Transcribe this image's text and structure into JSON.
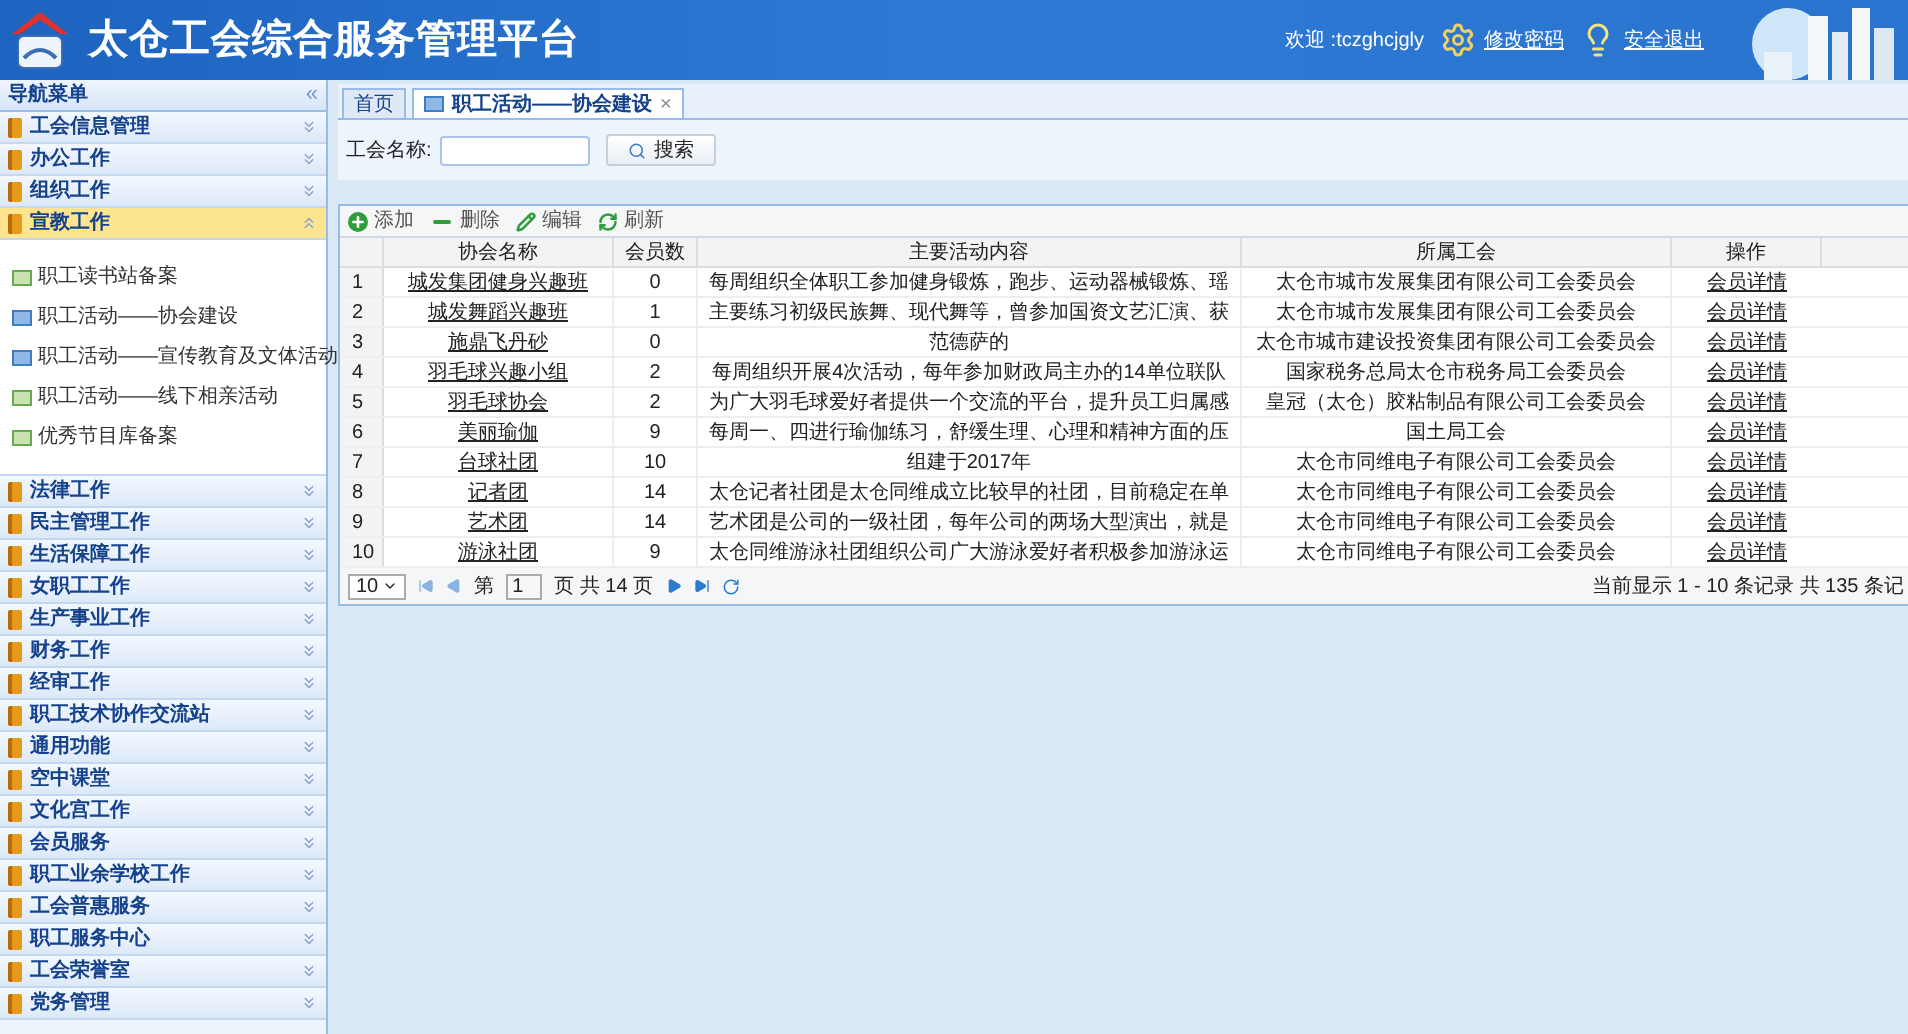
{
  "header": {
    "title": "太仓工会综合服务管理平台",
    "welcome": "欢迎 :tczghcjgly",
    "links": [
      "修改密码",
      "安全退出"
    ]
  },
  "sidebar": {
    "title": "导航菜单",
    "collapse": "«",
    "sections": [
      {
        "label": "工会信息管理",
        "expanded": false
      },
      {
        "label": "办公工作",
        "expanded": false
      },
      {
        "label": "组织工作",
        "expanded": false
      },
      {
        "label": "宣教工作",
        "expanded": true,
        "children": [
          {
            "label": "职工读书站备案",
            "kind": "green"
          },
          {
            "label": "职工活动——协会建设",
            "kind": "blue"
          },
          {
            "label": "职工活动——宣传教育及文体活动",
            "kind": "blue"
          },
          {
            "label": "职工活动——线下相亲活动",
            "kind": "green"
          },
          {
            "label": "优秀节目库备案",
            "kind": "green"
          }
        ]
      },
      {
        "label": "法律工作",
        "expanded": false
      },
      {
        "label": "民主管理工作",
        "expanded": false
      },
      {
        "label": "生活保障工作",
        "expanded": false
      },
      {
        "label": "女职工工作",
        "expanded": false
      },
      {
        "label": "生产事业工作",
        "expanded": false
      },
      {
        "label": "财务工作",
        "expanded": false
      },
      {
        "label": "经审工作",
        "expanded": false
      },
      {
        "label": "职工技术协作交流站",
        "expanded": false
      },
      {
        "label": "通用功能",
        "expanded": false
      },
      {
        "label": "空中课堂",
        "expanded": false
      },
      {
        "label": "文化宫工作",
        "expanded": false
      },
      {
        "label": "会员服务",
        "expanded": false
      },
      {
        "label": "职工业余学校工作",
        "expanded": false
      },
      {
        "label": "工会普惠服务",
        "expanded": false
      },
      {
        "label": "职工服务中心",
        "expanded": false
      },
      {
        "label": "工会荣誉室",
        "expanded": false
      },
      {
        "label": "党务管理",
        "expanded": false
      }
    ]
  },
  "tabs": [
    {
      "label": "首页",
      "selected": false
    },
    {
      "label": "职工活动——协会建设",
      "selected": true,
      "close": "×"
    }
  ],
  "search": {
    "label": "工会名称:",
    "button": "搜索"
  },
  "toolbar": [
    {
      "label": "添加",
      "kind": "add"
    },
    {
      "label": "删除",
      "kind": "remove"
    },
    {
      "label": "编辑",
      "kind": "edit"
    },
    {
      "label": "刷新",
      "kind": "refresh"
    }
  ],
  "table": {
    "columns": [
      "协会名称",
      "会员数",
      "主要活动内容",
      "所属工会",
      "操作"
    ],
    "rows": [
      {
        "n": "1",
        "name": "城发集团健身兴趣班",
        "members": "0",
        "content": "每周组织全体职工参加健身锻炼，跑步、运动器械锻炼、瑶",
        "union": "太仓市城市发展集团有限公司工会委员会",
        "action": "会员详情"
      },
      {
        "n": "2",
        "name": "城发舞蹈兴趣班",
        "members": "1",
        "content": "主要练习初级民族舞、现代舞等，曾参加国资文艺汇演、获",
        "union": "太仓市城市发展集团有限公司工会委员会",
        "action": "会员详情"
      },
      {
        "n": "3",
        "name": "施鼎飞丹砂",
        "members": "0",
        "content": "范德萨的",
        "union": "太仓市城市建设投资集团有限公司工会委员会",
        "action": "会员详情"
      },
      {
        "n": "4",
        "name": "羽毛球兴趣小组",
        "members": "2",
        "content": "每周组织开展4次活动，每年参加财政局主办的14单位联队",
        "union": "国家税务总局太仓市税务局工会委员会",
        "action": "会员详情"
      },
      {
        "n": "5",
        "name": "羽毛球协会",
        "members": "2",
        "content": "为广大羽毛球爱好者提供一个交流的平台，提升员工归属感",
        "union": "皇冠（太仓）胶粘制品有限公司工会委员会",
        "action": "会员详情"
      },
      {
        "n": "6",
        "name": "美丽瑜伽",
        "members": "9",
        "content": "每周一、四进行瑜伽练习，舒缓生理、心理和精神方面的压",
        "union": "国土局工会",
        "action": "会员详情"
      },
      {
        "n": "7",
        "name": "台球社团",
        "members": "10",
        "content": "组建于2017年",
        "union": "太仓市同维电子有限公司工会委员会",
        "action": "会员详情"
      },
      {
        "n": "8",
        "name": "记者团",
        "members": "14",
        "content": "太仓记者社团是太仓同维成立比较早的社团，目前稳定在单",
        "union": "太仓市同维电子有限公司工会委员会",
        "action": "会员详情"
      },
      {
        "n": "9",
        "name": "艺术团",
        "members": "14",
        "content": "艺术团是公司的一级社团，每年公司的两场大型演出，就是",
        "union": "太仓市同维电子有限公司工会委员会",
        "action": "会员详情"
      },
      {
        "n": "10",
        "name": "游泳社团",
        "members": "9",
        "content": "太仓同维游泳社团组织公司广大游泳爱好者积极参加游泳运",
        "union": "太仓市同维电子有限公司工会委员会",
        "action": "会员详情"
      }
    ]
  },
  "pager": {
    "page_size": "10",
    "page_prefix": "第",
    "page": "1",
    "page_suffix": "页 共 14 页",
    "summary": "当前显示 1 - 10 条记录 共 135 条记"
  }
}
